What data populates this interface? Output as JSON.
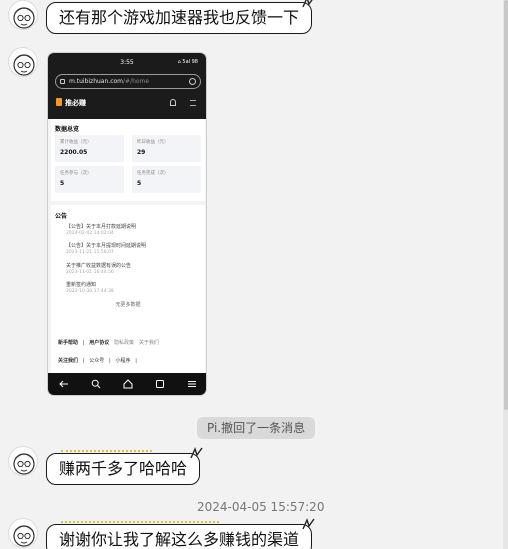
{
  "messages": [
    {
      "text": "还有那个游戏加速器我也反馈一下"
    },
    {
      "text": "赚两千多了哈哈哈"
    },
    {
      "text": "谢谢你让我了解这么多赚钱的渠道"
    }
  ],
  "recall_notice": "Pi.撤回了一条消息",
  "timestamp": "2024-04-05 15:57:20",
  "phone": {
    "time": "3:55",
    "status_right": "⌂ 5al 98",
    "url_host": "m.tuibizhuan.com",
    "url_path": "/#/home",
    "brand": "推必赚",
    "overview_title": "数据总览",
    "stats": [
      {
        "label": "累计收益（元）",
        "value": "2200.05"
      },
      {
        "label": "昨日收益（元）",
        "value": "29"
      },
      {
        "label": "任务参与（次）",
        "value": "5"
      },
      {
        "label": "任务完成（次）",
        "value": "5"
      }
    ],
    "notice_title": "公告",
    "notices": [
      {
        "title": "【公告】关于本月打款延期说明",
        "time": "2024-02-02 14:02:04"
      },
      {
        "title": "【公告】关于本月提现时间延期说明",
        "time": "2023-11-21 15:56:07"
      },
      {
        "title": "关于推广收益数据有误的公告",
        "time": "2023-11-01 16:44:56"
      },
      {
        "title": "重新签约通知",
        "time": "2023-10-30 17:44:38"
      }
    ],
    "more": "无更多数据",
    "footer_row1": [
      "新手帮助",
      "用户协议",
      "隐私政策",
      "关于我们"
    ],
    "footer_row2": [
      "关注我们",
      "公众号",
      "小程序"
    ]
  }
}
